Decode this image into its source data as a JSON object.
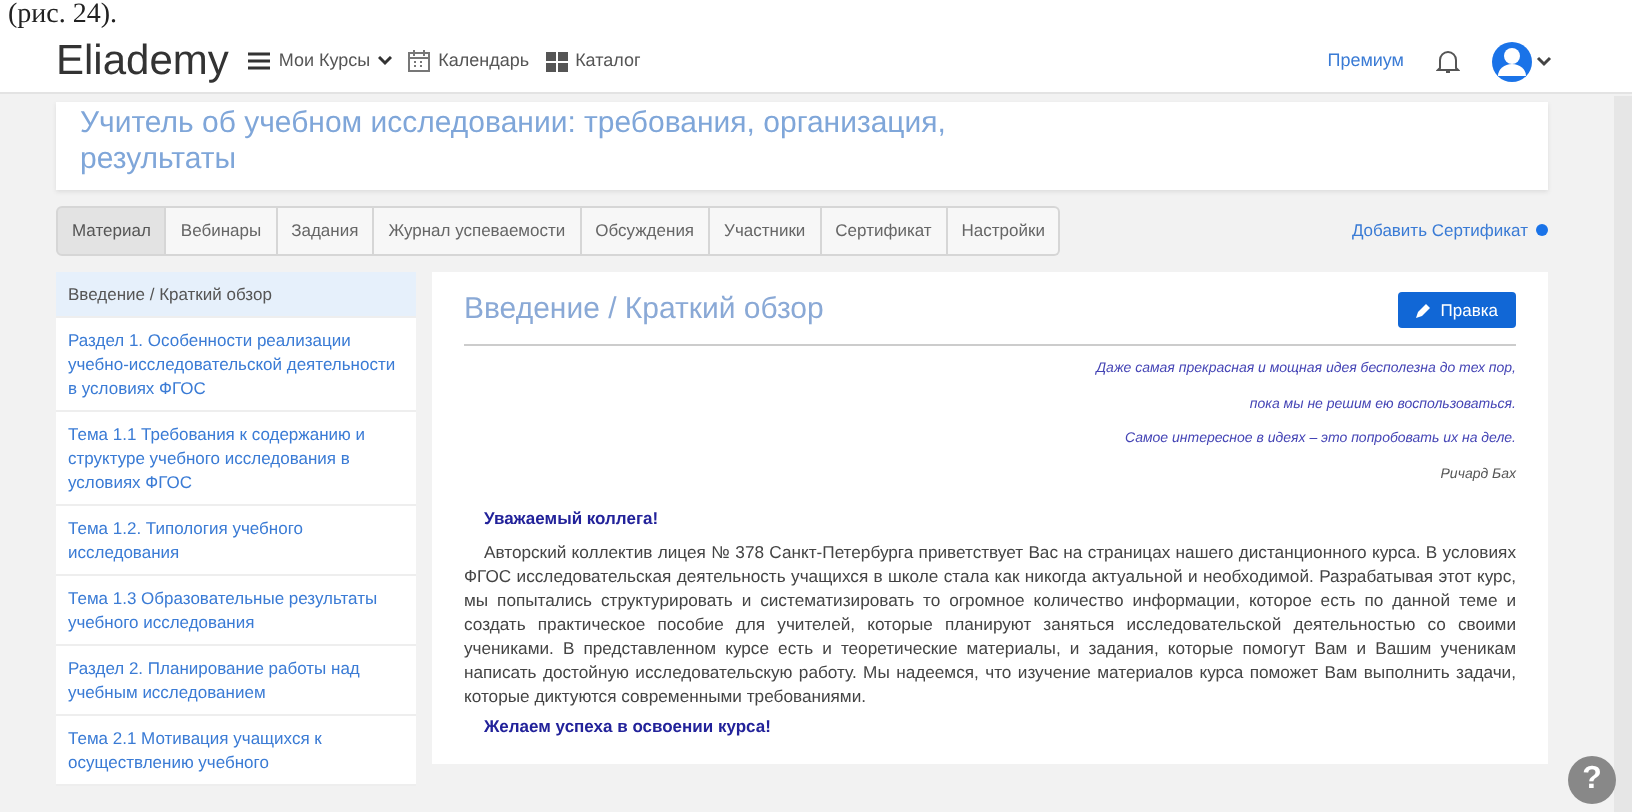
{
  "caption": "(рис. 24).",
  "navbar": {
    "logo": "Eliademy",
    "menu": [
      {
        "kind": "courses",
        "label": "Мои Курсы"
      },
      {
        "kind": "calendar",
        "label": "Календарь"
      },
      {
        "kind": "catalog",
        "label": "Каталог"
      }
    ],
    "premium": "Премиум"
  },
  "course_title": [
    "Учитель об учебном исследовании: требования, организация,",
    "результаты"
  ],
  "tabs": [
    {
      "label": "Материал",
      "selected": true
    },
    {
      "label": "Вебинары",
      "selected": false
    },
    {
      "label": "Задания",
      "selected": false
    },
    {
      "label": "Журнал успеваемости",
      "selected": false
    },
    {
      "label": "Обсуждения",
      "selected": false
    },
    {
      "label": "Участники",
      "selected": false
    },
    {
      "label": "Сертификат",
      "selected": false
    },
    {
      "label": "Настройки",
      "selected": false
    }
  ],
  "add_certificate": "Добавить Сертификат",
  "sidebar": {
    "items": [
      {
        "label": "Введение / Краткий обзор",
        "selected": true
      },
      {
        "label": "Раздел 1. Особенности реализации учебно-исследовательской деятельности в условиях ФГОС",
        "selected": false
      },
      {
        "label": "Тема 1.1 Требования к содержанию и структуре учебного исследования в условиях ФГОС",
        "selected": false
      },
      {
        "label": "Тема 1.2. Типология учебного исследования",
        "selected": false
      },
      {
        "label": "Тема 1.3 Образовательные результаты учебного исследования",
        "selected": false
      },
      {
        "label": "Раздел 2. Планирование работы над учебным исследованием",
        "selected": false
      },
      {
        "label": "Тема 2.1 Мотивация учащихся к осуществлению учебного",
        "selected": false
      }
    ]
  },
  "content": {
    "heading": "Введение / Краткий обзор",
    "edit_button": "Правка",
    "epigraph": [
      "Даже самая прекрасная  и мощная идея бесполезна до тех пор,",
      "пока мы не решим ею воспользоваться.",
      "Самое интересное в идеях – это попробовать их на деле."
    ],
    "epigraph_author": "Ричард Бах",
    "greeting": "Уважаемый коллега!",
    "paragraph": "Авторский коллектив лицея № 378 Санкт-Петербурга приветствует  Вас  на страницах нашего дистанционного курса.  В условиях ФГОС исследовательская деятельность учащихся в школе стала как никогда актуальной и необходимой.  Разрабатывая этот курс, мы попытались структурировать и систематизировать то огромное количество информации, которое есть по данной теме   и создать практическое пособие для учителей, которые планируют заняться исследовательской деятельностью со своими учениками. В представленном курсе есть  и теоретические материалы, и задания, которые помогут Вам  и Вашим ученикам написать достойную исследовательскую работу.  Мы надеемся, что изучение материалов курса поможет Вам выполнить задачи, которые диктуются современными требованиями.",
    "closing": "Желаем успеха в освоении курса!"
  },
  "help_button": "?"
}
